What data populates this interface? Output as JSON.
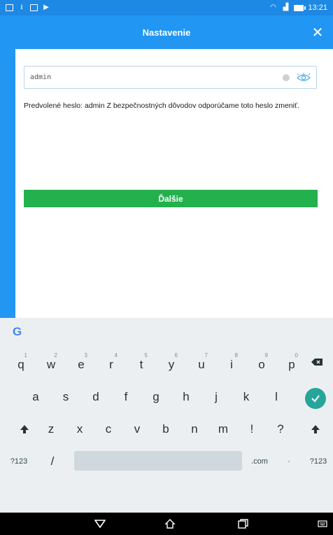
{
  "status_bar": {
    "time": "13:21"
  },
  "header": {
    "title": "Nastavenie",
    "close_glyph": "✕"
  },
  "password_field": {
    "value": "admin"
  },
  "hint_text": "Predvolené heslo: admin Z bezpečnostných dôvodov odporúčame toto heslo zmeniť.",
  "next_button": {
    "label": "Ďalšie"
  },
  "keyboard": {
    "logo": "G",
    "row1": [
      {
        "key": "q",
        "hint": "1"
      },
      {
        "key": "w",
        "hint": "2"
      },
      {
        "key": "e",
        "hint": "3"
      },
      {
        "key": "r",
        "hint": "4"
      },
      {
        "key": "t",
        "hint": "5"
      },
      {
        "key": "y",
        "hint": "6"
      },
      {
        "key": "u",
        "hint": "7"
      },
      {
        "key": "i",
        "hint": "8"
      },
      {
        "key": "o",
        "hint": "9"
      },
      {
        "key": "p",
        "hint": "0"
      }
    ],
    "row2": [
      "a",
      "s",
      "d",
      "f",
      "g",
      "h",
      "j",
      "k",
      "l"
    ],
    "row3": [
      "z",
      "x",
      "c",
      "v",
      "b",
      "n",
      "m",
      "!",
      "?"
    ],
    "row4": {
      "symbols_left": "?123",
      "slash": "/",
      "dotcom": ".com",
      "dot": "·",
      "symbols_right": "?123"
    }
  },
  "colors": {
    "brand": "#2196f3",
    "button": "#22b14c",
    "enter": "#26a69a"
  }
}
